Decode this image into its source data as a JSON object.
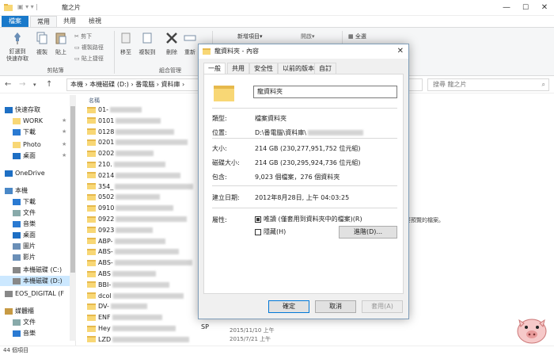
{
  "window": {
    "title": "龍之片",
    "minimize": "—",
    "maximize": "☐",
    "close": "✕"
  },
  "ribbon": {
    "tabs": [
      "檔案",
      "常用",
      "共用",
      "檢視"
    ],
    "pin": "釘選到\n快速存取",
    "copy": "複製",
    "paste": "貼上",
    "cut": "剪下",
    "copy_path": "複製路徑",
    "paste_shortcut": "貼上捷徑",
    "move_to": "移至",
    "copy_to": "複製到",
    "delete": "刪除",
    "rename": "重新",
    "new_item": "新增項目▾",
    "open": "開啟▾",
    "select_all": "全選",
    "clipboard_label": "剪貼簿",
    "organize_label": "組合管理"
  },
  "address": {
    "crumbs": "本機 › 本機磁碟 (D:) › 番電腦 › 資料庫 ›",
    "search_placeholder": "搜尋 龍之片"
  },
  "nav": {
    "items": [
      {
        "label": "快速存取",
        "icon": "star-icon"
      },
      {
        "label": "WORK",
        "icon": "folder-icon"
      },
      {
        "label": "下載",
        "icon": "download-icon"
      },
      {
        "label": "Photo",
        "icon": "folder-icon"
      },
      {
        "label": "桌面",
        "icon": "desktop-icon"
      },
      {
        "label": "OneDrive",
        "icon": "cloud-icon"
      },
      {
        "label": "本機",
        "icon": "pc-icon"
      },
      {
        "label": "下載",
        "icon": "download-icon"
      },
      {
        "label": "文件",
        "icon": "document-icon"
      },
      {
        "label": "音樂",
        "icon": "music-icon"
      },
      {
        "label": "桌面",
        "icon": "desktop-icon"
      },
      {
        "label": "圖片",
        "icon": "picture-icon"
      },
      {
        "label": "影片",
        "icon": "video-icon"
      },
      {
        "label": "本機磁碟 (C:)",
        "icon": "drive-icon"
      },
      {
        "label": "本機磁碟 (D:)",
        "icon": "drive-icon"
      },
      {
        "label": "EOS_DIGITAL (F",
        "icon": "drive-icon"
      },
      {
        "label": "媒體櫃",
        "icon": "library-icon"
      },
      {
        "label": "文件",
        "icon": "document-icon"
      },
      {
        "label": "音樂",
        "icon": "music-icon"
      }
    ]
  },
  "filelist": {
    "column_name": "名稱",
    "rows": [
      "01-",
      "0101",
      "0128",
      "0201",
      "0202",
      "210.",
      "0214",
      "354_",
      "0502",
      "0910",
      "0922",
      "0923",
      "ABP-",
      "ABS-",
      "ABS-",
      "ABS",
      "BBI-",
      "dcol",
      "DV-",
      "ENF",
      "Hey",
      "LZD"
    ],
    "date_1": "2015/11/10 上午",
    "date_2": "2015/7/21 上午",
    "sp_fragment": "SP"
  },
  "sidetext": "要預覽的檔案。",
  "status": "44 個項目",
  "dialog": {
    "title": "龍資料夾 - 內容",
    "close": "✕",
    "tabs": [
      "一般",
      "共用",
      "安全性",
      "以前的版本",
      "自訂"
    ],
    "name": "龍資料夾",
    "props": [
      {
        "label": "類型:",
        "value": "檔案資料夾"
      },
      {
        "label": "位置:",
        "value": "D:\\番電腦\\資料庫\\"
      },
      {
        "label": "大小:",
        "value": "214 GB (230,277,951,752 位元組)"
      },
      {
        "label": "磁碟大小:",
        "value": "214 GB (230,295,924,736 位元組)"
      },
      {
        "label": "包含:",
        "value": "9,023 個檔案，276 個資料夾"
      },
      {
        "label": "建立日期:",
        "value": "2012年8月28日, 上午 04:03:25"
      }
    ],
    "attributes_label": "屬性:",
    "readonly_label": "唯讀 (僅套用到資料夾中的檔案)(R)",
    "hidden_label": "隱藏(H)",
    "advanced_button": "進階(D)...",
    "ok_button": "確定",
    "cancel_button": "取消",
    "apply_button": "套用(A)"
  }
}
